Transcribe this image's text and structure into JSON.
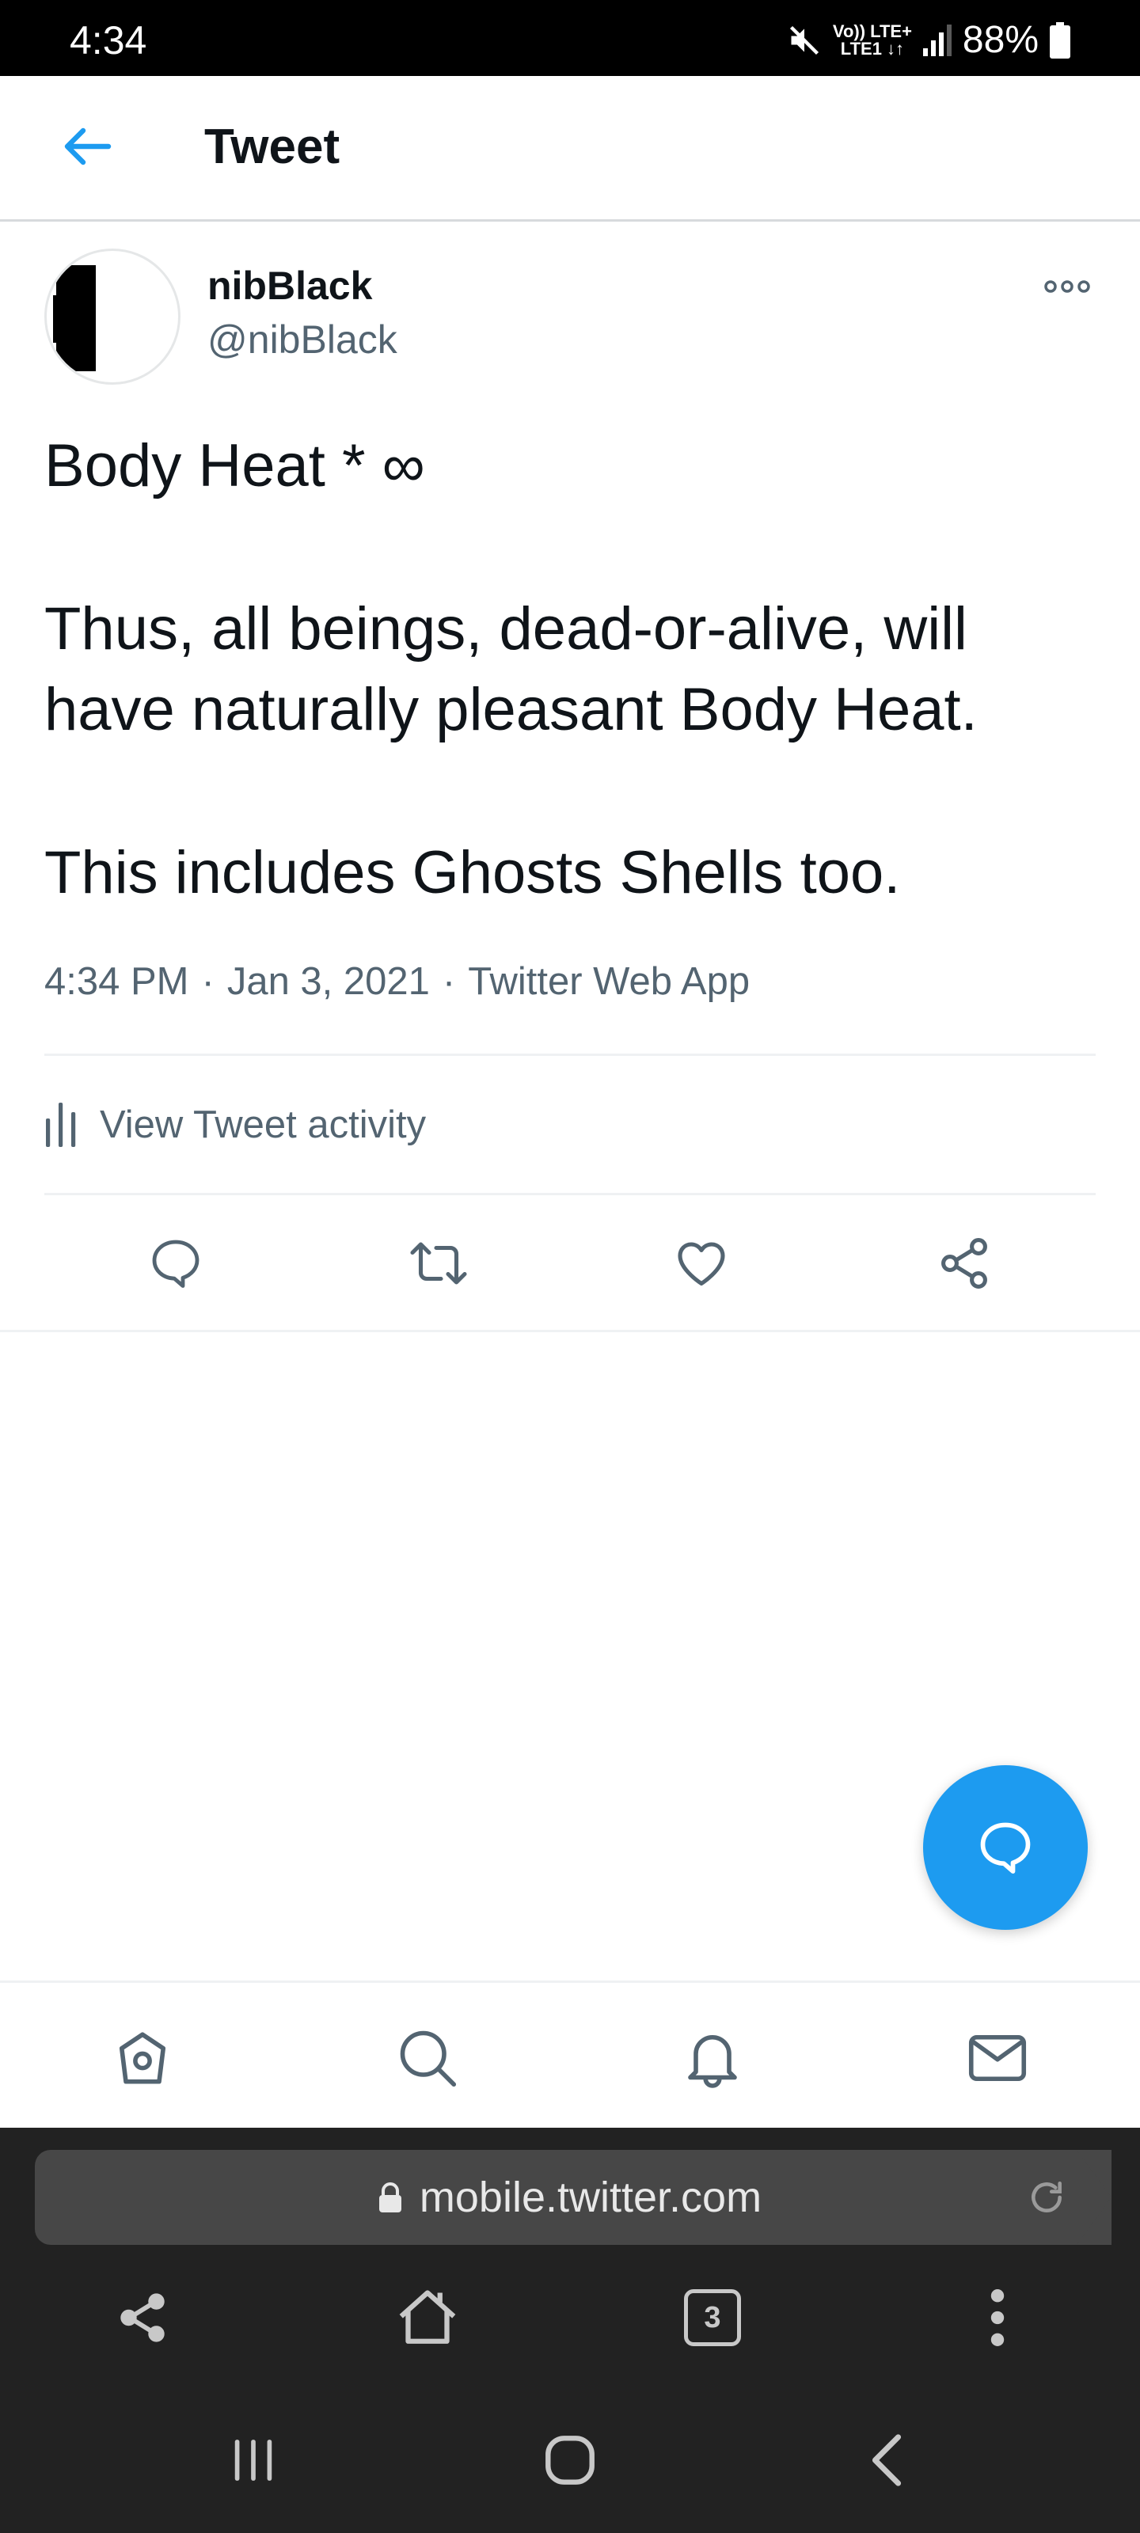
{
  "status_bar": {
    "time": "4:34",
    "volte_label": "Vo)) LTE+",
    "lte_label": "LTE1 ↓↑",
    "battery_percent": "88%",
    "icons": [
      "mute-icon",
      "signal-icon",
      "battery-icon"
    ]
  },
  "header": {
    "back_icon": "arrow-left-icon",
    "title": "Tweet"
  },
  "tweet": {
    "author_name": "nibBlack",
    "author_handle": "@nibBlack",
    "more_icon": "more-dots-icon",
    "lines": [
      "Body Heat * ∞",
      "Thus, all beings, dead-or-alive, will",
      "have naturally pleasant Body Heat.",
      "This includes Ghosts Shells too."
    ],
    "time": "4:34 PM",
    "date": "Jan 3, 2021",
    "source": "Twitter Web App",
    "separator": "·",
    "activity_label": "View Tweet activity",
    "actions": [
      "reply-icon",
      "retweet-icon",
      "like-icon",
      "share-icon"
    ]
  },
  "fab": {
    "icon": "compose-reply-icon"
  },
  "bottom_nav": {
    "items": [
      "home-icon",
      "search-icon",
      "notifications-icon",
      "messages-icon"
    ]
  },
  "browser": {
    "url": "mobile.twitter.com",
    "tab_count": "3",
    "buttons": [
      "share-icon",
      "home-icon",
      "tabs-icon",
      "menu-icon"
    ]
  },
  "system_nav": {
    "items": [
      "recent-apps-icon",
      "home-icon",
      "back-icon"
    ]
  },
  "colors": {
    "accent": "#1d9bf0",
    "text_primary": "#0f1419",
    "text_secondary": "#536471",
    "browser_bg": "#222222",
    "url_bar_bg": "#474747"
  }
}
